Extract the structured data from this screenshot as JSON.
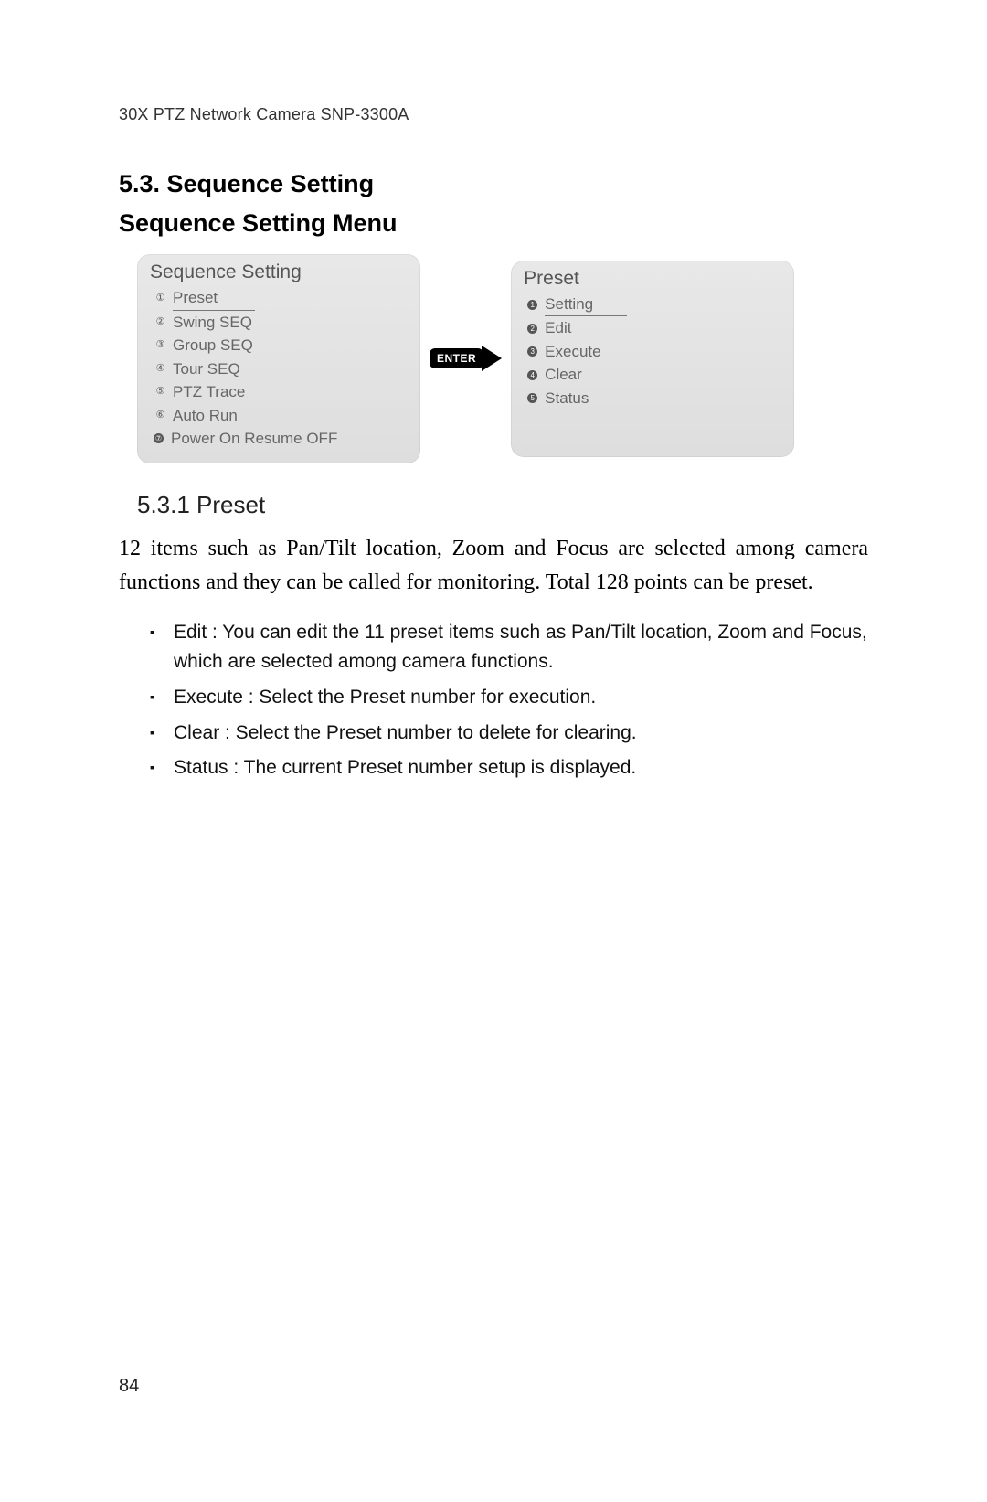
{
  "header": "30X PTZ Network Camera SNP-3300A",
  "section_heading": "5.3. Sequence Setting",
  "subheading": "Sequence Setting Menu",
  "left_panel": {
    "title": "Sequence Setting",
    "items": [
      {
        "num": "①",
        "label": "Preset",
        "selected": true
      },
      {
        "num": "②",
        "label": "Swing SEQ",
        "selected": false
      },
      {
        "num": "③",
        "label": "Group SEQ",
        "selected": false
      },
      {
        "num": "④",
        "label": "Tour SEQ",
        "selected": false
      },
      {
        "num": "⑤",
        "label": "PTZ Trace",
        "selected": false
      },
      {
        "num": "⑥",
        "label": "Auto Run",
        "selected": false
      },
      {
        "num": "⑦",
        "label": "Power On Resume OFF",
        "selected": false
      }
    ]
  },
  "enter_label": "ENTER",
  "right_panel": {
    "title": "Preset",
    "items": [
      {
        "num": "1",
        "label": "Setting",
        "selected": true
      },
      {
        "num": "2",
        "label": "Edit",
        "selected": false
      },
      {
        "num": "3",
        "label": "Execute",
        "selected": false
      },
      {
        "num": "4",
        "label": "Clear",
        "selected": false
      },
      {
        "num": "5",
        "label": "Status",
        "selected": false
      }
    ]
  },
  "sub_section_heading": "5.3.1 Preset",
  "body_text": "12 items such as Pan/Tilt location, Zoom and Focus are selected among camera functions and they can be called for monitoring. Total 128 points can be preset.",
  "bullets": [
    "Edit : You can edit the 11 preset items such as Pan/Tilt location, Zoom and Focus, which are selected among camera functions.",
    "Execute : Select the Preset number for execution.",
    "Clear : Select the Preset number to delete for clearing.",
    "Status : The current Preset number setup is displayed."
  ],
  "page_number": "84"
}
